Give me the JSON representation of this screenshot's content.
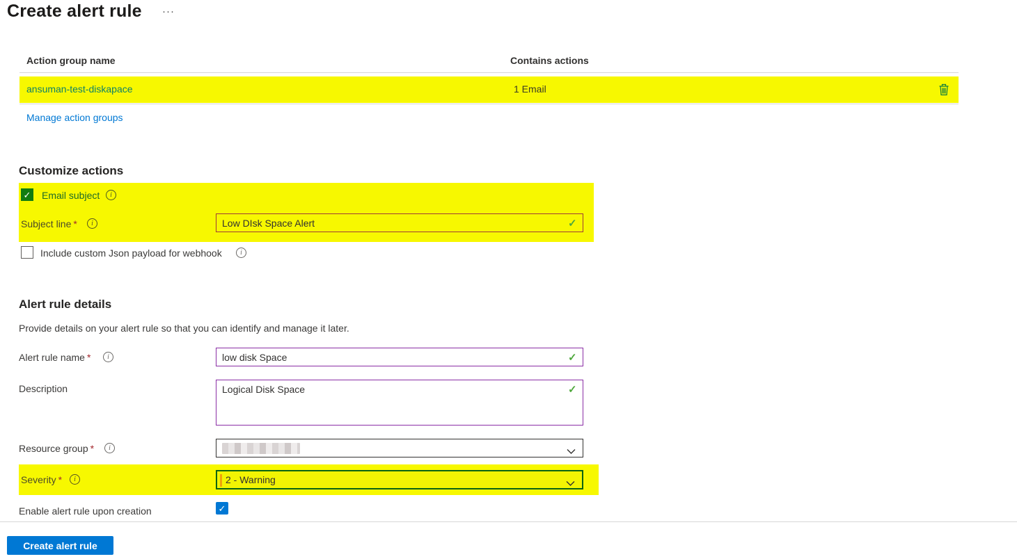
{
  "page": {
    "title": "Create alert rule",
    "more_label": "···"
  },
  "icons": {
    "check": "✓",
    "info": "i"
  },
  "ui": {
    "required_marker": "*"
  },
  "action_groups": {
    "columns": {
      "name": "Action group name",
      "contains": "Contains actions"
    },
    "rows": [
      {
        "name": "ansuman-test-diskapace",
        "contains": "1 Email"
      }
    ],
    "manage_link": "Manage action groups"
  },
  "customize_actions": {
    "heading": "Customize actions",
    "email_subject": {
      "label": "Email subject",
      "checked": true
    },
    "subject_line": {
      "label": "Subject line",
      "value": "Low DIsk Space Alert"
    },
    "webhook": {
      "label": "Include custom Json payload for webhook",
      "checked": false
    }
  },
  "alert_rule_details": {
    "heading": "Alert rule details",
    "intro": "Provide details on your alert rule so that you can identify and manage it later.",
    "alert_rule_name": {
      "label": "Alert rule name",
      "value": "low disk Space"
    },
    "description": {
      "label": "Description",
      "value": "Logical Disk Space"
    },
    "resource_group": {
      "label": "Resource group",
      "value_redacted": true
    },
    "severity": {
      "label": "Severity",
      "value": "2 - Warning"
    },
    "enable": {
      "label": "Enable alert rule upon creation",
      "checked": true
    }
  },
  "footer": {
    "create_button": "Create alert rule"
  },
  "colors": {
    "accent": "#0078d4",
    "highlight": "#f7f800",
    "checkbox_green": "#107c10",
    "valid_green": "#4fa83d",
    "edited_field_border": "#8a2da5",
    "severity_border": "#0b6413",
    "row_name_text": "#0e8168",
    "required_red": "#a4262c"
  }
}
